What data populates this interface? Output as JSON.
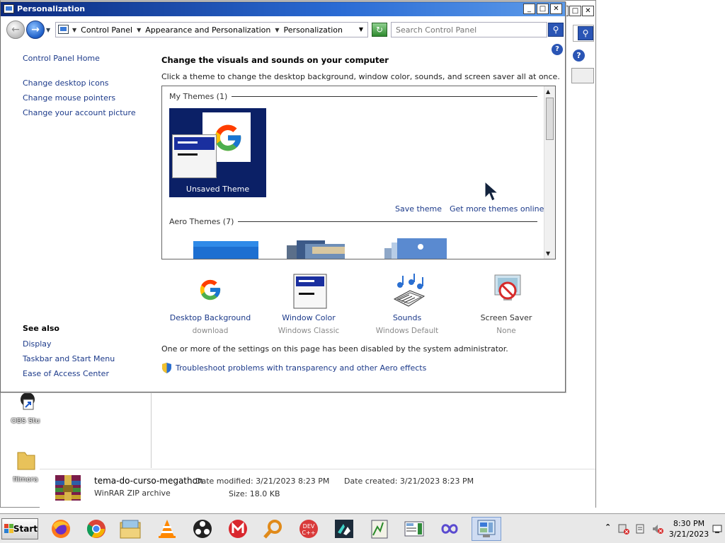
{
  "window": {
    "title": "Personalization",
    "min_label": "_",
    "max_label": "□",
    "close_label": "✕"
  },
  "address": {
    "crumbs": [
      "Control Panel",
      "Appearance and Personalization",
      "Personalization"
    ]
  },
  "search": {
    "placeholder": "Search Control Panel"
  },
  "left_nav": {
    "home": "Control Panel Home",
    "tasks": [
      "Change desktop icons",
      "Change mouse pointers",
      "Change your account picture"
    ],
    "see_also_title": "See also",
    "see_also": [
      "Display",
      "Taskbar and Start Menu",
      "Ease of Access Center"
    ]
  },
  "main": {
    "heading": "Change the visuals and sounds on your computer",
    "subheading": "Click a theme to change the desktop background, window color, sounds, and screen saver all at once.",
    "my_themes_label": "My Themes (1)",
    "unsaved_theme": "Unsaved Theme",
    "save_theme": "Save theme",
    "get_more": "Get more themes online",
    "aero_label": "Aero Themes (7)",
    "options": [
      {
        "label": "Desktop Background",
        "sub": "download"
      },
      {
        "label": "Window Color",
        "sub": "Windows Classic"
      },
      {
        "label": "Sounds",
        "sub": "Windows Default"
      },
      {
        "label": "Screen Saver",
        "sub": "None"
      }
    ],
    "disabled_note": "One or more of the settings on this page has been disabled by the system administrator.",
    "troubleshoot": "Troubleshoot problems with transparency and other Aero effects",
    "help": "?"
  },
  "background_window": {
    "file_name": "tema-do-curso-megathon",
    "file_type": "WinRAR ZIP archive",
    "date_modified": "Date modified:  3/21/2023 8:23 PM",
    "size": "Size:  18.0 KB",
    "date_created": "Date created:  3/21/2023 8:23 PM"
  },
  "desktop": {
    "icons": [
      "OBS Stu",
      "filmora"
    ]
  },
  "taskbar": {
    "start": "Start",
    "apps": [
      "firefox-icon",
      "chrome-icon",
      "file-explorer-icon",
      "vlc-icon",
      "obs-icon",
      "mega-icon",
      "search-tool-icon",
      "devcpp-icon",
      "filmora-icon",
      "notepad-icon",
      "image-viewer-icon",
      "infinity-app-icon",
      "control-panel-icon"
    ],
    "time": "8:30 PM",
    "date": "3/21/2023"
  },
  "colors": {
    "link": "#1c3a8a",
    "titlebar_start": "#0c2a7e",
    "titlebar_end": "#5d9bea",
    "theme_bg": "#0b2066",
    "window_color_bar": "#1a2f9f"
  }
}
